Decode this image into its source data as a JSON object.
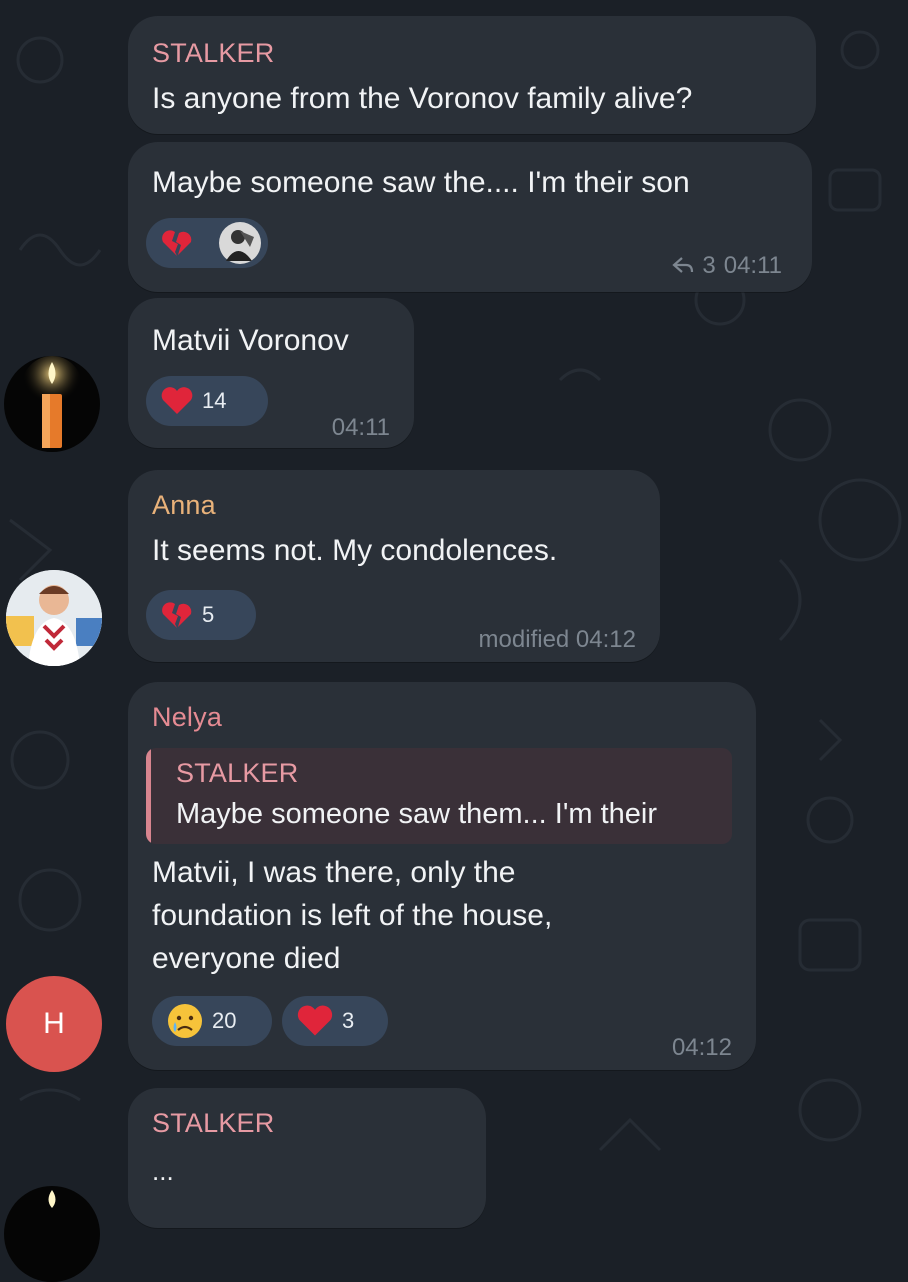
{
  "colors": {
    "background": "#1b2027",
    "bubble": "#2a3038",
    "reaction_bg": "#37465a",
    "stalker_name": "#e79aa3",
    "anna_name": "#e9b27a",
    "nelya_name": "#e58b93",
    "timestamp": "#7d8690",
    "heart": "#e0253a",
    "avatar_h": "#d9534f"
  },
  "messages": [
    {
      "sender": "STALKER",
      "text": "Is anyone from the Voronov family alive?"
    },
    {
      "text": "Maybe someone saw the.... I'm their son",
      "reactions": [
        {
          "icon": "broken-heart-icon"
        },
        {
          "icon": "user-avatar-icon"
        }
      ],
      "forward_icon": "share-arrow-icon",
      "forward_count": "3",
      "time": "04:11"
    },
    {
      "text": "Matvii Voronov",
      "reactions": [
        {
          "icon": "red-heart-icon",
          "count": "14"
        }
      ],
      "time": "04:11",
      "avatar_icon": "candle-icon"
    },
    {
      "sender": "Anna",
      "text": "It seems not. My condolences.",
      "reactions": [
        {
          "icon": "broken-heart-icon",
          "count": "5"
        }
      ],
      "time": "modified 04:12",
      "avatar_icon": "person-photo-icon"
    },
    {
      "sender": "Nelya",
      "quote": {
        "sender": "STALKER",
        "text": "Maybe someone saw them... I'm their"
      },
      "text_lines": [
        "Matvii, I was there, only the",
        "foundation  is left of the house,",
        "everyone died"
      ],
      "reactions": [
        {
          "icon": "crying-face-icon",
          "count": "20"
        },
        {
          "icon": "red-heart-icon",
          "count": "3"
        }
      ],
      "time": "04:12",
      "avatar_letter": "H"
    },
    {
      "sender": "STALKER",
      "text": "..."
    }
  ]
}
